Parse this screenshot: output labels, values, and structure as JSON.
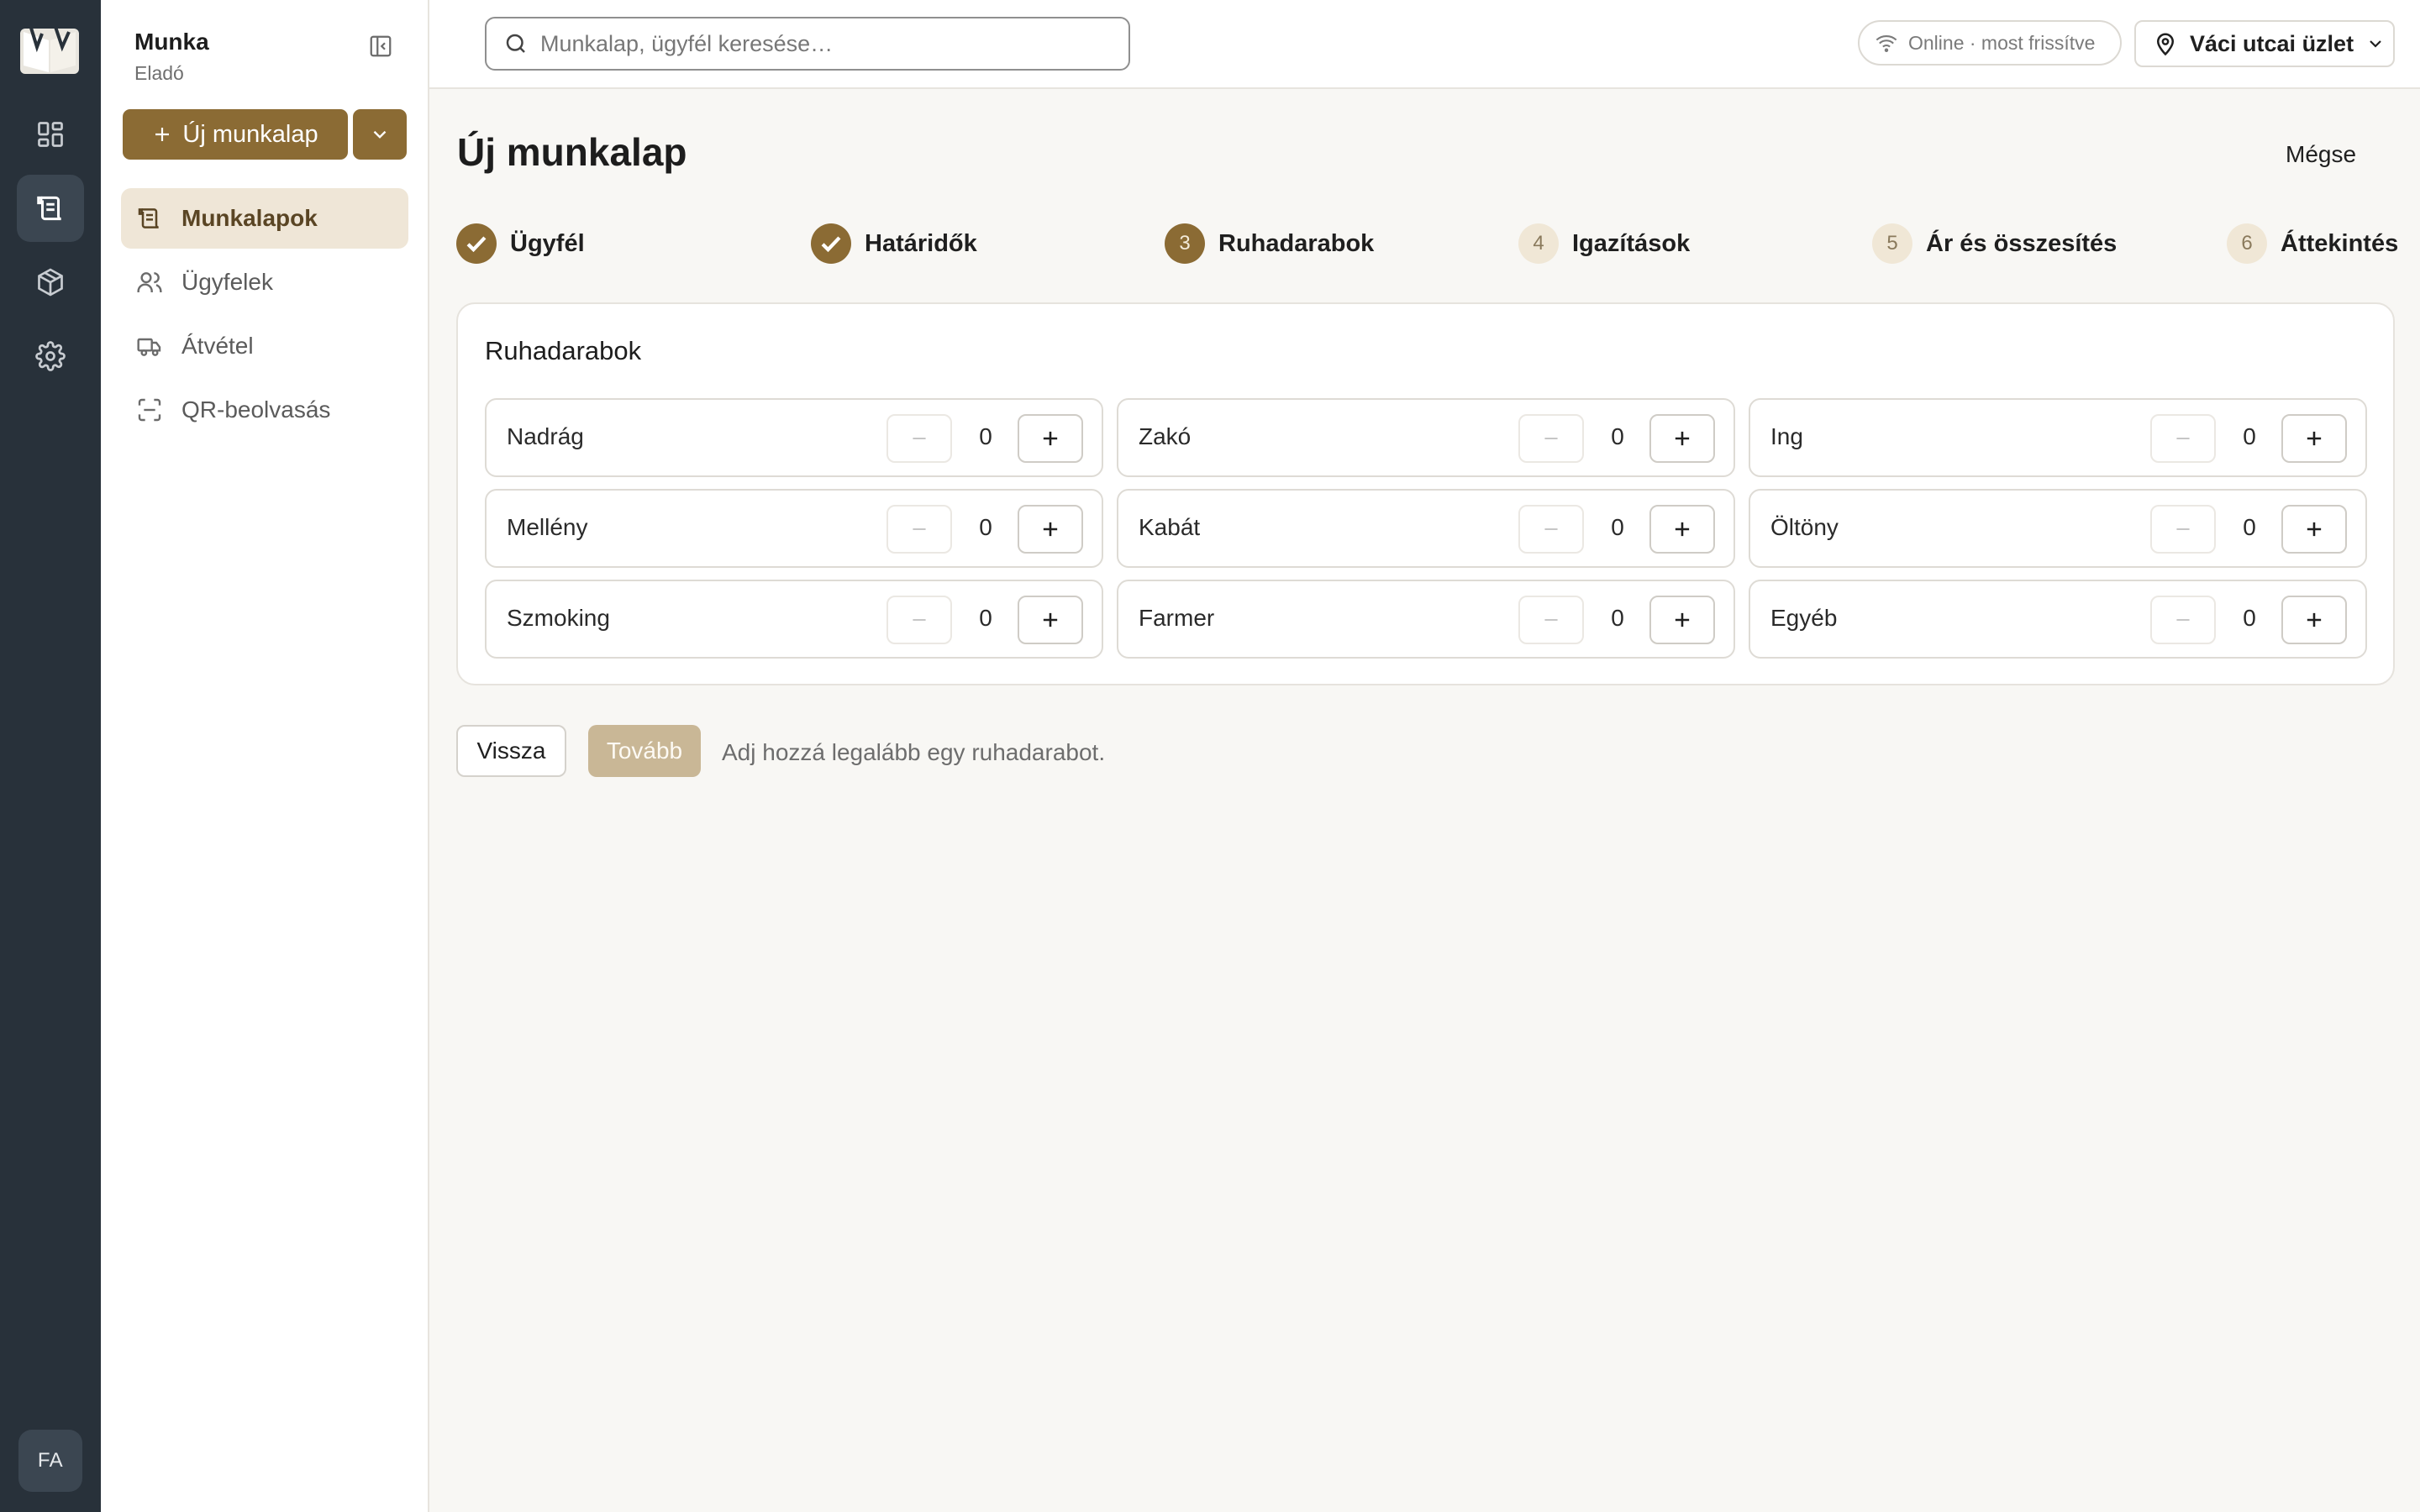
{
  "rail": {
    "items": [
      {
        "icon": "dashboard-icon"
      },
      {
        "icon": "worksheet-icon",
        "active": true
      },
      {
        "icon": "package-icon"
      },
      {
        "icon": "gear-icon"
      }
    ],
    "avatar": "FA"
  },
  "sidebar": {
    "title": "Munka",
    "subtitle": "Eladó",
    "new_button": "Új munkalap",
    "items": [
      {
        "label": "Munkalapok",
        "icon": "worksheet-icon",
        "active": true
      },
      {
        "label": "Ügyfelek",
        "icon": "users-icon"
      },
      {
        "label": "Átvétel",
        "icon": "truck-icon"
      },
      {
        "label": "QR-beolvasás",
        "icon": "qr-scan-icon"
      }
    ]
  },
  "topbar": {
    "search_placeholder": "Munkalap, ügyfél keresése…",
    "status": "Online · most frissítve",
    "store": "Váci utcai üzlet"
  },
  "main": {
    "title": "Új munkalap",
    "cancel": "Mégse",
    "steps": [
      {
        "number": "1",
        "label": "Ügyfél",
        "state": "done"
      },
      {
        "number": "2",
        "label": "Határidők",
        "state": "done"
      },
      {
        "number": "3",
        "label": "Ruhadarabok",
        "state": "current"
      },
      {
        "number": "4",
        "label": "Igazítások",
        "state": "todo"
      },
      {
        "number": "5",
        "label": "Ár és összesítés",
        "state": "todo"
      },
      {
        "number": "6",
        "label": "Áttekintés",
        "state": "todo"
      }
    ],
    "card_title": "Ruhadarabok",
    "garments": [
      {
        "label": "Nadrág",
        "qty": "0"
      },
      {
        "label": "Zakó",
        "qty": "0"
      },
      {
        "label": "Ing",
        "qty": "0"
      },
      {
        "label": "Mellény",
        "qty": "0"
      },
      {
        "label": "Kabát",
        "qty": "0"
      },
      {
        "label": "Öltöny",
        "qty": "0"
      },
      {
        "label": "Szmoking",
        "qty": "0"
      },
      {
        "label": "Farmer",
        "qty": "0"
      },
      {
        "label": "Egyéb",
        "qty": "0"
      }
    ],
    "back": "Vissza",
    "next": "Tovább",
    "hint": "Adj hozzá legalább egy ruhadarabot."
  },
  "colors": {
    "accent": "#8b6b34",
    "rail_bg": "#28313a",
    "active_nav_bg": "#efe6d7"
  }
}
